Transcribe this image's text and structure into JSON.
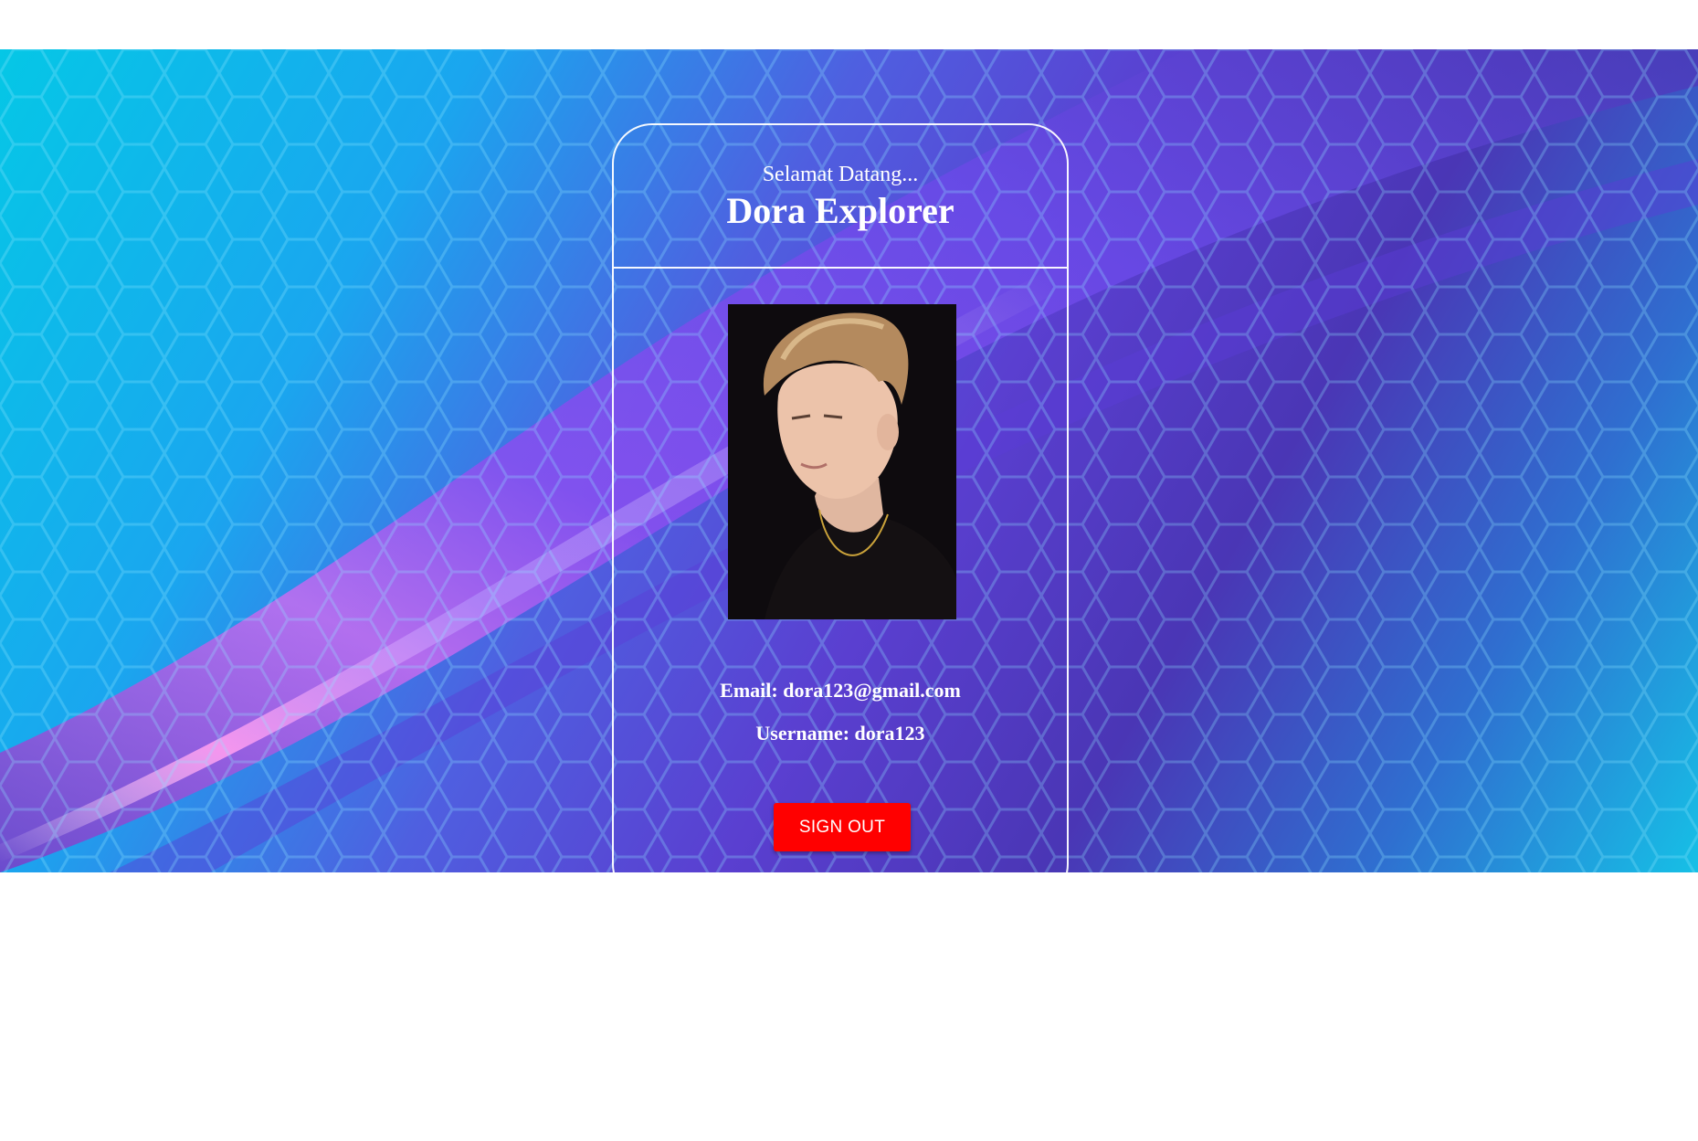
{
  "profile_card": {
    "greeting": "Selamat Datang...",
    "display_name": "Dora Explorer",
    "email_label": "Email: dora123@gmail.com",
    "username_label": "Username: dora123",
    "sign_out_label": "SIGN OUT"
  },
  "colors": {
    "sign_out_button": "#ff0000",
    "card_border": "#ffffff",
    "text": "#ffffff"
  },
  "icons": {
    "profile_photo": "profile-photo"
  }
}
